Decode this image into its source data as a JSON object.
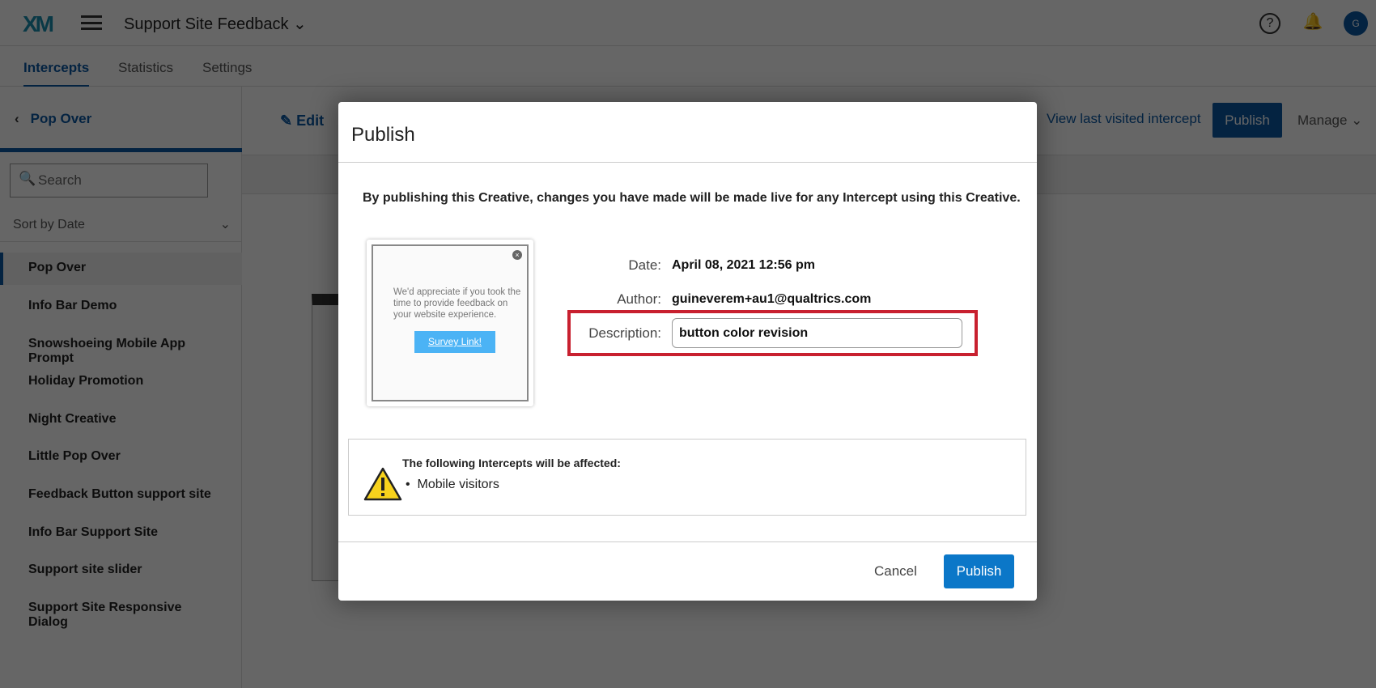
{
  "header": {
    "logo": "XM",
    "project": "Support Site Feedback",
    "help": "?",
    "avatar": "G"
  },
  "tabs": [
    {
      "label": "Intercepts"
    },
    {
      "label": "Statistics"
    },
    {
      "label": "Settings"
    }
  ],
  "sidebar": {
    "back_label": "Pop Over",
    "search_placeholder": "Search",
    "sort": "Sort by Date",
    "items": [
      "Pop Over",
      "Info Bar Demo",
      "Snowshoeing Mobile App Prompt",
      "Holiday Promotion",
      "Night Creative",
      "Little Pop Over",
      "Feedback Button support site",
      "Info Bar Support Site",
      "Support site slider",
      "Support Site Responsive Dialog"
    ]
  },
  "toolbar": {
    "edit": "Edit",
    "view_last": "View last visited intercept",
    "publish": "Publish",
    "manage": "Manage"
  },
  "dialog": {
    "title": "Publish",
    "message": "By publishing this Creative, changes you have made will be made live for any Intercept using this Creative.",
    "preview": {
      "text": "We'd appreciate if you took the time to provide feedback on your website experience.",
      "button": "Survey Link!"
    },
    "date_label": "Date:",
    "date": "April 08, 2021 12:56 pm",
    "author_label": "Author:",
    "author": "guineverem+au1@qualtrics.com",
    "description_label": "Description:",
    "description": "button color revision",
    "warning_heading": "The following Intercepts will be affected:",
    "affected": [
      "Mobile visitors"
    ],
    "cancel": "Cancel",
    "publish": "Publish"
  }
}
